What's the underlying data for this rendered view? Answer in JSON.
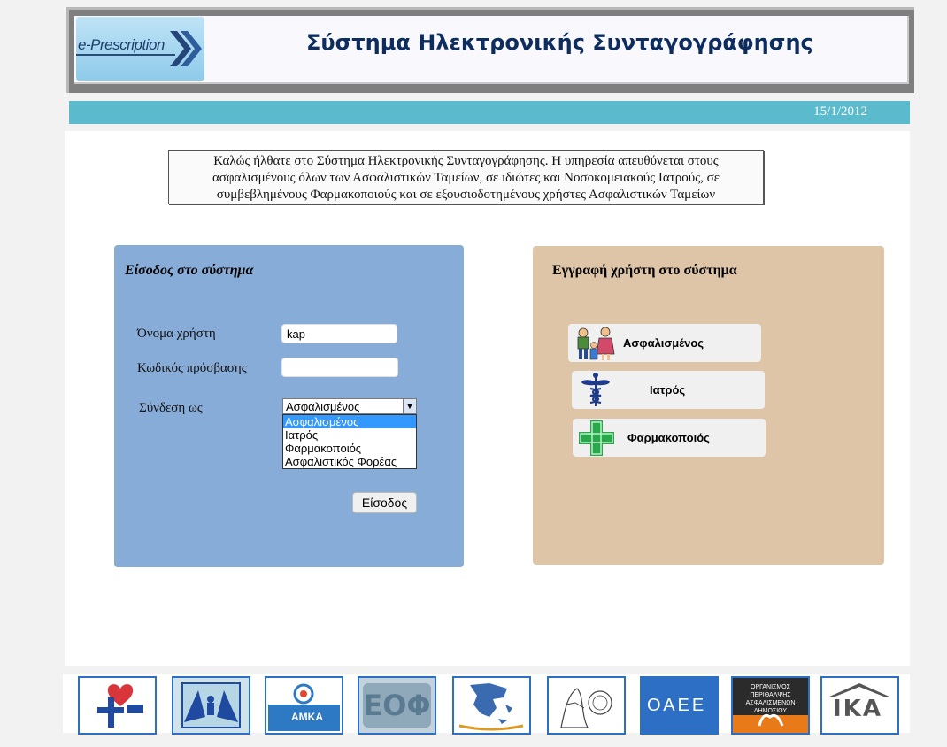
{
  "header": {
    "logo_text": "e-Prescription",
    "title": "Σύστημα Ηλεκτρονικής Συνταγογράφησης"
  },
  "datebar": {
    "date": "15/1/2012"
  },
  "welcome": {
    "lines": [
      "Καλώς ήλθατε στο Σύστημα Ηλεκτρονικής Συνταγογράφησης. Η υπηρεσία απευθύνεται στους",
      "ασφαλισμένους όλων των Ασφαλιστικών Ταμείων, σε ιδιώτες και Νοσοκομειακούς Ιατρούς, σε",
      "συμβεβλημένους Φαρμακοποιούς και σε εξουσιοδοτημένους χρήστες Ασφαλιστικών Ταμείων"
    ]
  },
  "login": {
    "title": "Είσοδος στο σύστημα",
    "username_label": "Όνομα χρήστη",
    "username_value": "kap",
    "password_label": "Κωδικός πρόσβασης",
    "password_value": "",
    "role_label": "Σύνδεση ως",
    "role_selected": "Ασφαλισμένος",
    "role_options": [
      "Ασφαλισμένος",
      "Ιατρός",
      "Φαρμακοποιός",
      "Ασφαλιστικός Φορέας"
    ],
    "submit_label": "Είσοδος"
  },
  "register": {
    "title": "Εγγραφή χρήστη στο σύστημα",
    "options": [
      {
        "label": "Ασφαλισμένος",
        "icon": "family-icon"
      },
      {
        "label": "Ιατρός",
        "icon": "caduceus-icon"
      },
      {
        "label": "Φαρμακοποιός",
        "icon": "pharmacy-cross-icon"
      }
    ]
  },
  "footer": {
    "logo_texts": {
      "amka": "ΑΜΚΑ",
      "eof": "ΕΟΦ",
      "oaee": "ΟΑΕΕ",
      "opad": "ΟΡΓΑΝΙΣΜΟΣ ΠΕΡΙΘΑΛΨΗΣ ΑΣΦΑΛΙΣΜΕΝΩΝ ΔΗΜΟΣΙΟΥ",
      "ika": "ΙΚΑ"
    }
  },
  "colors": {
    "datebar": "#5bbacb",
    "login_panel": "#88acd8",
    "register_panel": "#dfc5a8",
    "title": "#0e2d5f",
    "footer_border": "#2d6fc4"
  }
}
